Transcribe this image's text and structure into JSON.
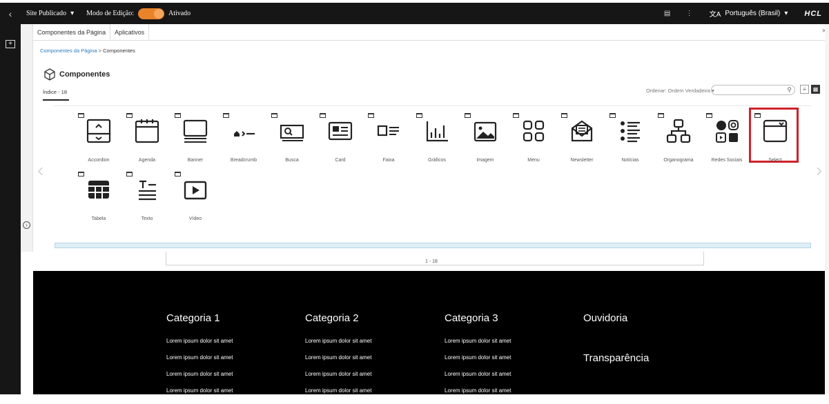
{
  "topbar": {
    "back_glyph": "‹",
    "site_label": "Site Publicado",
    "edit_mode_label": "Modo de Edição:",
    "edit_mode_state": "Ativado",
    "language": "Português (Brasil)",
    "brand": "HCL",
    "toggle_color": "#e8832a"
  },
  "panel": {
    "tabs": [
      "Componentes da Página",
      "Aplicativos"
    ],
    "close_glyph": "×",
    "breadcrumb": {
      "root": "Componentes da Página",
      "sep": ">",
      "current": "Componentes"
    },
    "title": "Componentes",
    "subtab": "Índice - 18",
    "sort_label": "Ordenar:  Ordem Verdadeira",
    "search_placeholder": "",
    "pager": "1 - 18"
  },
  "components": [
    {
      "label": "Accordion",
      "icon": "accordion-icon"
    },
    {
      "label": "Agenda",
      "icon": "calendar-icon"
    },
    {
      "label": "Banner",
      "icon": "banner-icon"
    },
    {
      "label": "Breadcrumb",
      "icon": "breadcrumb-icon"
    },
    {
      "label": "Busca",
      "icon": "search-box-icon"
    },
    {
      "label": "Card",
      "icon": "card-icon"
    },
    {
      "label": "Faixa",
      "icon": "strip-icon"
    },
    {
      "label": "Gráficos",
      "icon": "bar-chart-icon"
    },
    {
      "label": "Imagem",
      "icon": "image-icon"
    },
    {
      "label": "Menu",
      "icon": "menu-grid-icon"
    },
    {
      "label": "Newsletter",
      "icon": "newsletter-icon"
    },
    {
      "label": "Notícias",
      "icon": "news-list-icon"
    },
    {
      "label": "Organograma",
      "icon": "org-chart-icon"
    },
    {
      "label": "Redes Sociais",
      "icon": "social-icon"
    },
    {
      "label": "Select",
      "icon": "select-icon",
      "selected": true
    },
    {
      "label": "Tabela",
      "icon": "table-icon"
    },
    {
      "label": "Texto",
      "icon": "text-icon"
    },
    {
      "label": "Vídeo",
      "icon": "video-icon"
    }
  ],
  "footer": {
    "columns": [
      {
        "title": "Categoria 1",
        "links": [
          "Lorem ipsum dolor sit amet",
          "Lorem ipsum dolor sit amet",
          "Lorem ipsum dolor sit amet",
          "Lorem ipsum dolor sit amet"
        ]
      },
      {
        "title": "Categoria 2",
        "links": [
          "Lorem ipsum dolor sit amet",
          "Lorem ipsum dolor sit amet",
          "Lorem ipsum dolor sit amet",
          "Lorem ipsum dolor sit amet"
        ]
      },
      {
        "title": "Categoria 3",
        "links": [
          "Lorem ipsum dolor sit amet",
          "Lorem ipsum dolor sit amet",
          "Lorem ipsum dolor sit amet",
          "Lorem ipsum dolor sit amet"
        ]
      }
    ],
    "ouvidoria": "Ouvidoria",
    "transparencia": "Transparência"
  },
  "selection_color": "#d0202a"
}
